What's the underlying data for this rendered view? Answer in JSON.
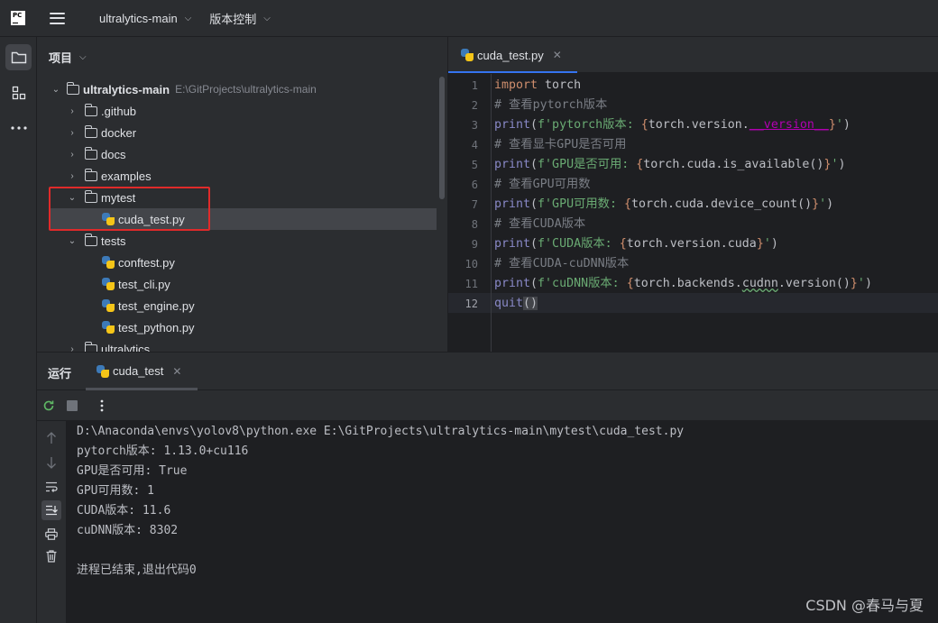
{
  "titlebar": {
    "logo_text": "PC",
    "project_name": "ultralytics-main",
    "vcs_label": "版本控制"
  },
  "toolstrip": {
    "items": [
      {
        "icon": "folder-icon",
        "active": true
      },
      {
        "icon": "structure-icon",
        "active": false
      },
      {
        "icon": "more-icon",
        "active": false
      }
    ]
  },
  "project": {
    "header": "项目",
    "root": {
      "name": "ultralytics-main",
      "path": "E:\\GitProjects\\ultralytics-main"
    },
    "items": [
      {
        "name": ".github",
        "type": "folder",
        "expanded": false,
        "depth": 1
      },
      {
        "name": "docker",
        "type": "folder",
        "expanded": false,
        "depth": 1
      },
      {
        "name": "docs",
        "type": "folder",
        "expanded": false,
        "depth": 1
      },
      {
        "name": "examples",
        "type": "folder",
        "expanded": false,
        "depth": 1
      },
      {
        "name": "mytest",
        "type": "folder",
        "expanded": true,
        "depth": 1
      },
      {
        "name": "cuda_test.py",
        "type": "python",
        "depth": 2,
        "selected": true
      },
      {
        "name": "tests",
        "type": "folder",
        "expanded": true,
        "depth": 1
      },
      {
        "name": "conftest.py",
        "type": "python",
        "depth": 2
      },
      {
        "name": "test_cli.py",
        "type": "python",
        "depth": 2
      },
      {
        "name": "test_engine.py",
        "type": "python",
        "depth": 2
      },
      {
        "name": "test_python.py",
        "type": "python",
        "depth": 2
      },
      {
        "name": "ultralytics",
        "type": "folder",
        "expanded": false,
        "depth": 1
      }
    ]
  },
  "editor": {
    "tab": {
      "label": "cuda_test.py"
    },
    "current_line": 12,
    "line_numbers": [
      "1",
      "2",
      "3",
      "4",
      "5",
      "6",
      "7",
      "8",
      "9",
      "10",
      "11",
      "12"
    ],
    "code": {
      "l1_kw": "import",
      "l1_rest": " torch",
      "l2": "# 查看pytorch版本",
      "l3_fn": "print",
      "l3_a": "(",
      "l3_str1": "f'pytorch版本: ",
      "l3_b1": "{",
      "l3_expr": "torch.version.",
      "l3_dunder": "__version__",
      "l3_b2": "}",
      "l3_str2": "'",
      "l3_z": ")",
      "l4": "# 查看显卡GPU是否可用",
      "l5_fn": "print",
      "l5_a": "(",
      "l5_str1": "f'GPU是否可用: ",
      "l5_b1": "{",
      "l5_expr": "torch.cuda.is_available()",
      "l5_b2": "}",
      "l5_str2": "'",
      "l5_z": ")",
      "l6": "# 查看GPU可用数",
      "l7_fn": "print",
      "l7_a": "(",
      "l7_str1": "f'GPU可用数: ",
      "l7_b1": "{",
      "l7_expr": "torch.cuda.device_count()",
      "l7_b2": "}",
      "l7_str2": "'",
      "l7_z": ")",
      "l8": "# 查看CUDA版本",
      "l9_fn": "print",
      "l9_a": "(",
      "l9_str1": "f'CUDA版本: ",
      "l9_b1": "{",
      "l9_expr": "torch.version.cuda",
      "l9_b2": "}",
      "l9_str2": "'",
      "l9_z": ")",
      "l10": "# 查看CUDA-cuDNN版本",
      "l11_fn": "print",
      "l11_a": "(",
      "l11_str1": "f'cuDNN版本: ",
      "l11_b1": "{",
      "l11_expr1": "torch.backends.",
      "l11_wavy": "cudnn",
      "l11_expr2": ".version()",
      "l11_b2": "}",
      "l11_str2": "'",
      "l11_z": ")",
      "l12_fn": "quit",
      "l12_paren": "()"
    }
  },
  "run": {
    "label": "运行",
    "tab_label": "cuda_test",
    "console": [
      "D:\\Anaconda\\envs\\yolov8\\python.exe E:\\GitProjects\\ultralytics-main\\mytest\\cuda_test.py",
      "pytorch版本: 1.13.0+cu116",
      "GPU是否可用: True",
      "GPU可用数: 1",
      "CUDA版本: 11.6",
      "cuDNN版本: 8302",
      "",
      "进程已结束,退出代码0"
    ]
  },
  "watermark": "CSDN @春马与夏",
  "colors": {
    "accent": "#3574f0",
    "highlight_box": "#e02a2a",
    "keyword": "#cf8e6d",
    "string": "#6aab73",
    "comment": "#7a7e85"
  }
}
